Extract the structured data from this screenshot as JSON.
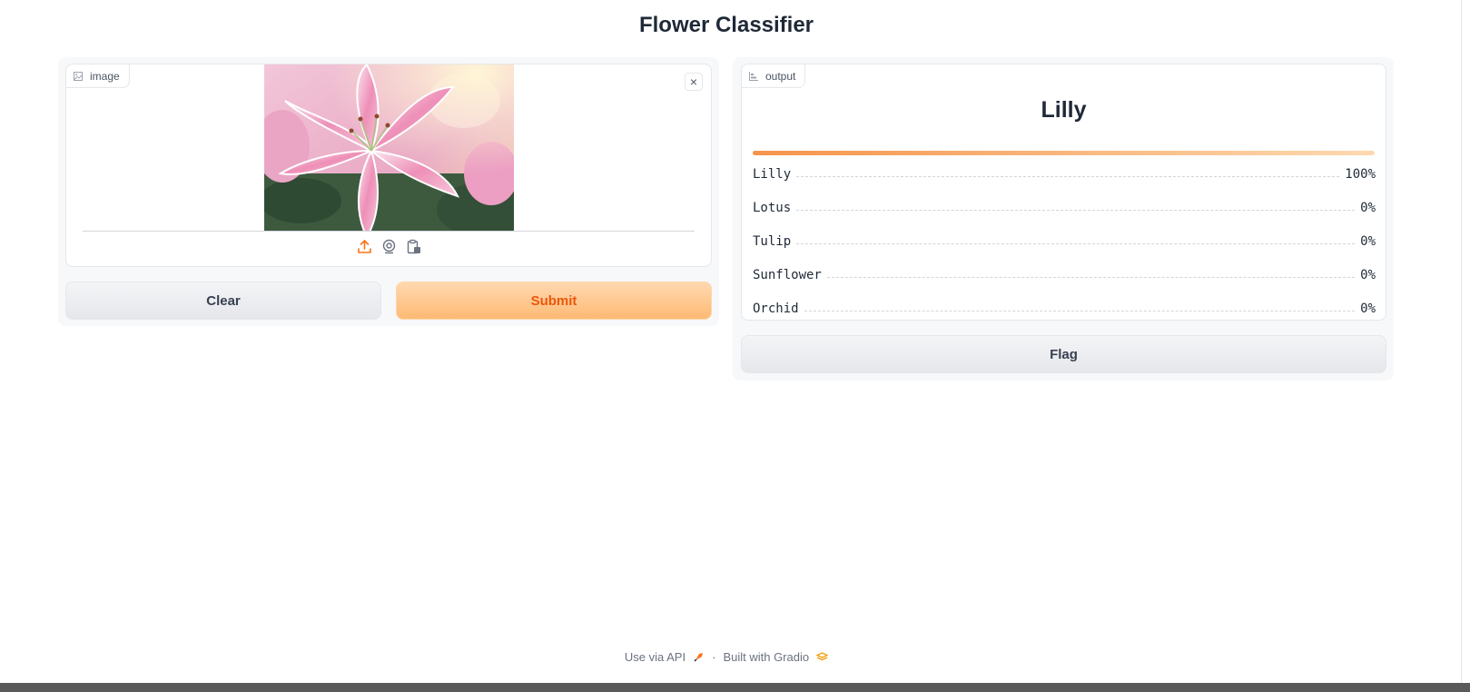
{
  "app": {
    "title": "Flower Classifier"
  },
  "input": {
    "label": "image",
    "label_icon": "image-icon",
    "close_icon": "close-icon",
    "close_glyph": "×",
    "source_icons": [
      "upload-icon",
      "webcam-icon",
      "clipboard-icon"
    ]
  },
  "buttons": {
    "clear": "Clear",
    "submit": "Submit",
    "flag": "Flag"
  },
  "output": {
    "label": "output",
    "label_icon": "bar-chart-icon",
    "top_class": "Lilly",
    "top_confidence": 1.0,
    "confidences": [
      {
        "label": "Lilly",
        "value": "100%"
      },
      {
        "label": "Lotus",
        "value": "0%"
      },
      {
        "label": "Tulip",
        "value": "0%"
      },
      {
        "label": "Sunflower",
        "value": "0%"
      },
      {
        "label": "Orchid",
        "value": "0%"
      }
    ]
  },
  "footer": {
    "api_link": "Use via API",
    "separator": "·",
    "built_with": "Built with Gradio"
  },
  "colors": {
    "accent": "#ea580c",
    "accent_light": "#fdba74"
  }
}
